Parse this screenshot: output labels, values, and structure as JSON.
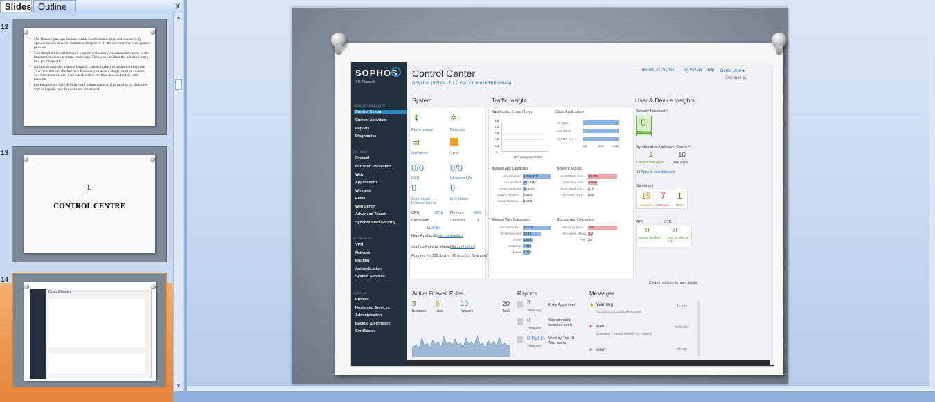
{
  "pane": {
    "tab_slides": "Slides",
    "tab_outline": "Outline",
    "close": "x"
  },
  "thumbnails": [
    {
      "number": "12",
      "bullets": [
        "The firewall gateway feature enables additional end-to-end connectivity options for use in environments with specific TCP/IP connection management policies.",
        "You install a firewall between your network and your connection point to the Internet (or other un-trusted network). Then you can limit the points of entry into your network.",
        "A firewall provides a single point of contact (called a checkpoint) between your network and the Internet. Because you have a single point of contact, you havemore control over which traffic to allow into and out of your network.",
        "For this project, SOPHOS firewall online demo will be used as an elaborate way to explain how firewalls are monitored."
      ]
    },
    {
      "number": "13",
      "line1": "1.",
      "line2": "CONTROL CENTRE"
    },
    {
      "number": "14",
      "caption": "Control Center"
    }
  ],
  "slide": {
    "brand": "SOPHOS",
    "brand_sub": "XG Firewall",
    "title": "Control Center",
    "subtitle": "SFVUNL (SFOS 17.1.0 GA) C01001KTPBKHM04",
    "top_links": {
      "guides": "How-To Guides",
      "log": "Log Viewer",
      "help": "Help",
      "user": "Demo User ▾",
      "org": "Sophos Inc"
    },
    "nav": {
      "sec1": "MONITOR & ANALYZE",
      "items1": [
        "Control Center",
        "Current Activities",
        "Reports",
        "Diagnostics"
      ],
      "sec2": "PROTECT",
      "items2": [
        "Firewall",
        "Intrusion Prevention",
        "Web",
        "Applications",
        "Wireless",
        "Email",
        "Web Server",
        "Advanced Threat",
        "Synchronized Security"
      ],
      "sec3": "CONFIGURE",
      "items3": [
        "VPN",
        "Network",
        "Routing",
        "Authentication",
        "System Services"
      ],
      "sec4": "SYSTEM",
      "items4": [
        "Profiles",
        "Hosts and Services",
        "Administration",
        "Backup & Firmware",
        "Certificates"
      ]
    },
    "system": {
      "heading": "System",
      "performance": "Performance",
      "services": "Services",
      "interfaces": "Interfaces",
      "vpn": "VPN",
      "red": "RED",
      "red_val": "0/0",
      "wireless": "Wireless APs",
      "wireless_val": "0/0",
      "remote": "Connected Remote Users",
      "remote_val": "0",
      "live": "Live Users",
      "live_val": "0",
      "cpu": "CPU",
      "cpu_val": "52%",
      "memory": "Memory",
      "memory_val": "56%",
      "bandwidth": "Bandwidth",
      "sessions": "Sessions",
      "sessions_val": "0",
      "bw_val": "110KB/s",
      "ha": "High Availability:",
      "ha_val": "Not configured",
      "sfm": "Sophos Firewall Manager:",
      "sfm_val": "Not configured",
      "uptime": "Running for 112 day(s), 10 hour(s), 3 minute(s)"
    },
    "traffic": {
      "heading": "Traffic Insight",
      "web_activity": "Web Activity 1 max | 1 avg",
      "yticks": [
        "1.5",
        "1.2",
        "0.9",
        "0.6",
        "0.3",
        "0"
      ],
      "hits": "Hits every 5 minutes",
      "cloud": "Cloud Applications",
      "cloud_rows": [
        "10 Apps",
        "106 MB In",
        "723 MB Out"
      ],
      "cloud_ticks": [
        "0%",
        "50%",
        "100%"
      ],
      "allowed_app": "Allowed App Categories",
      "allowed_app_rows": [
        {
          "label": "Infrastructure",
          "value": "1,085.37M"
        },
        {
          "label": "Unclassified",
          "value": "163.61M"
        },
        {
          "label": "General Internet",
          "value": "95.81M"
        },
        {
          "label": "Instant Messen...",
          "value": "6.82M"
        },
        {
          "label": "Social Network...",
          "value": "4.13M"
        }
      ],
      "network_attacks": "Network Attacks",
      "attack_rows": [
        {
          "label": "DoS/DDoS Com...",
          "value": "10.09K"
        },
        {
          "label": "Operating Syst...",
          "value": "3.49K"
        },
        {
          "label": "DoS/DDoS Com...",
          "value": "379"
        },
        {
          "label": "Microsoft OS O...",
          "value": "156"
        }
      ],
      "allowed_web": "Allowed Web Categories",
      "web_rows": [
        {
          "label": "Information Te...",
          "value": "20.73K"
        },
        {
          "label": "Entertainment",
          "value": "13.7K"
        },
        {
          "label": "None",
          "value": "6.52K"
        },
        {
          "label": "Weapons",
          "value": "5.01K"
        },
        {
          "label": "News",
          "value": "4.34K"
        }
      ],
      "blocked_app": "Blocked App Categories",
      "blocked_rows": [
        {
          "label": "Mobile Applicat...",
          "value": "766"
        },
        {
          "label": "Streaming Media",
          "value": "111"
        },
        {
          "label": "P2P",
          "value": "30"
        }
      ]
    },
    "user": {
      "heading": "User & Device Insights",
      "heartbeat": "Security Heartbeat™",
      "hb_val": "0",
      "hb_label": "Connected",
      "sac": "Synchronized Application Control™",
      "cat_val": "2",
      "cat_label": "Categorized Apps",
      "new_val": "10",
      "new_label": "New Apps",
      "detected": "12 Apps in total detected",
      "sandstorm": "Sandstorm",
      "suspect_val": "15",
      "suspect": "Suspect",
      "malicious_val": "7",
      "malicious": "Malicious",
      "clean_val": "1",
      "clean": "Clean",
      "atp": "ATP",
      "utq": "UTQ",
      "atp_val": "0",
      "atp_label": "Source blocked",
      "utq_val": "0",
      "utq_label": "Acc. for 80% of risk"
    },
    "click_hint": "Click on widgets to open details",
    "rules": {
      "heading": "Active Firewall Rules",
      "business_val": "5",
      "business": "Business",
      "user_val": "5",
      "user": "User",
      "network_val": "10",
      "network": "Network",
      "total_val": "20",
      "total": "Total"
    },
    "reports": {
      "heading": "Reports",
      "r1_val": "3",
      "r1_sub": "Yesterday",
      "r1": "Risky Apps seen",
      "r2_val": "0",
      "r2_sub": "Yesterday",
      "r2": "Objectionable websites seen",
      "r3_val": "0 bytes",
      "r3_sub": "Yesterday",
      "r3": "Used by Top 10 Web users"
    },
    "messages": {
      "heading": "Messages",
      "m1": "Warning",
      "m1_sub": "SandstormScanSizeMessage",
      "m1_time": "1y ago",
      "m2": "Alert",
      "m2_sub": "Essential Firewall module(s) expired",
      "m2_time": "Yesterday",
      "m3": "Alert",
      "m3_time": "3d ago"
    }
  }
}
